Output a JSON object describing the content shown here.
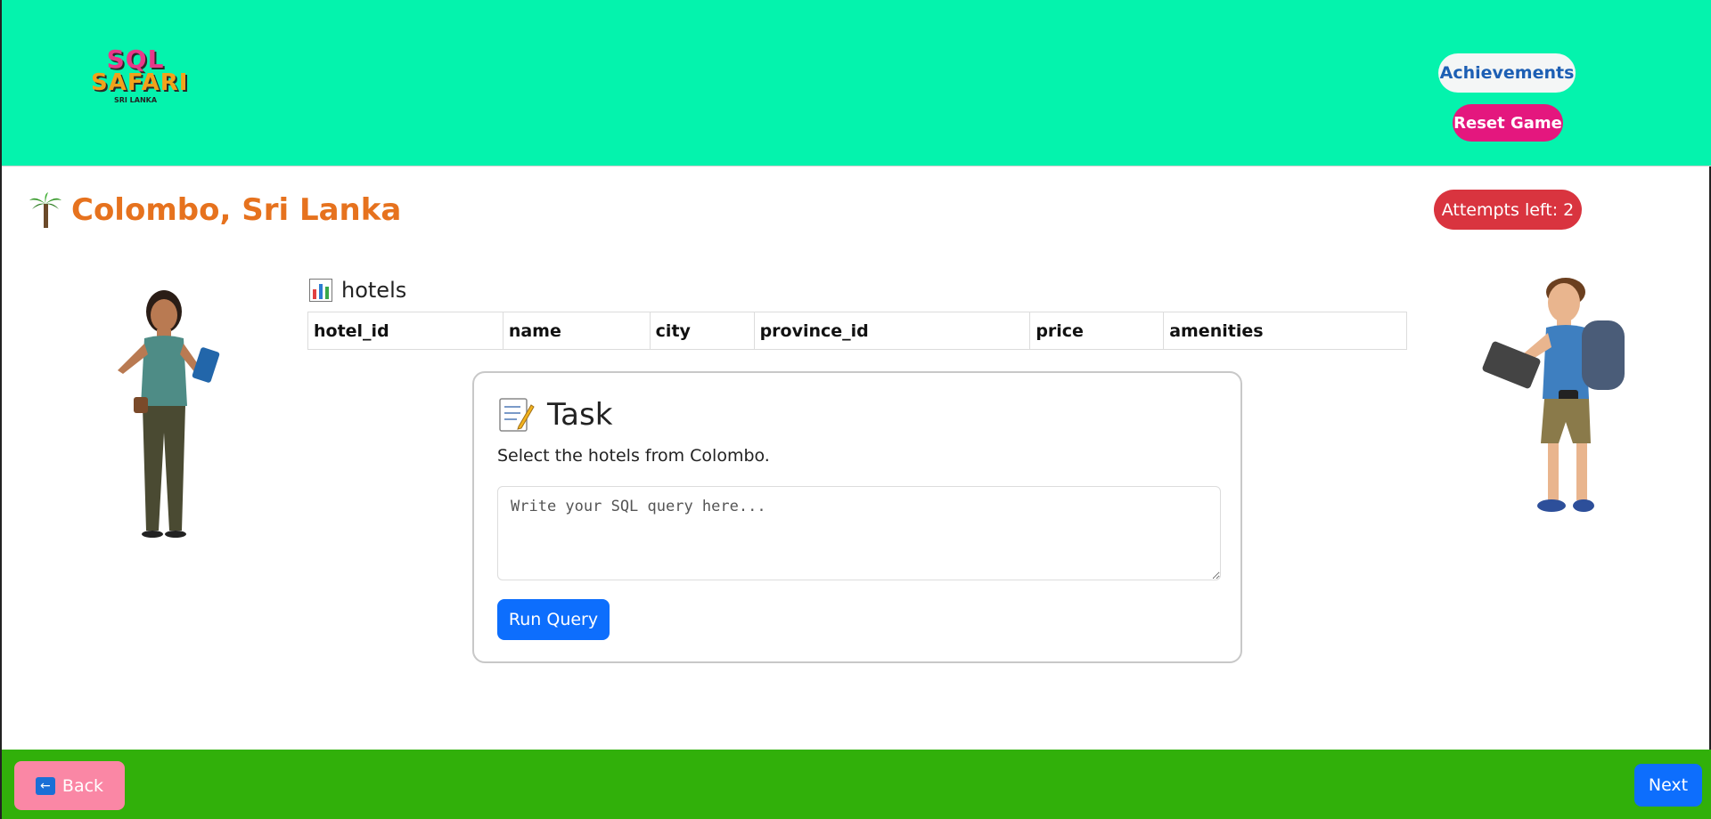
{
  "header": {
    "logo": {
      "line1": "SQL",
      "line2": "SAFARI",
      "line3": "SRI LANKA"
    },
    "achievements_label": "Achievements",
    "reset_label": "Reset Game",
    "colors": {
      "header_bg": "#04f3ad",
      "reset_bg": "#e4177e"
    }
  },
  "level": {
    "title": "Colombo, Sri Lanka",
    "title_icon": "palm-tree-icon",
    "attempts_label": "Attempts left: 2"
  },
  "table": {
    "icon": "bar-chart-icon",
    "name": "hotels",
    "columns": [
      "hotel_id",
      "name",
      "city",
      "province_id",
      "price",
      "amenities"
    ]
  },
  "task": {
    "icon": "memo-icon",
    "heading": "Task",
    "description": "Select the hotels from Colombo.",
    "query_placeholder": "Write your SQL query here...",
    "query_value": "",
    "run_label": "Run Query"
  },
  "footer": {
    "back_label": "Back",
    "back_icon": "left-arrow-icon",
    "next_label": "Next",
    "colors": {
      "footer_bg": "#31b00a",
      "back_bg": "#fa87a5",
      "next_bg": "#0d6efd"
    }
  }
}
